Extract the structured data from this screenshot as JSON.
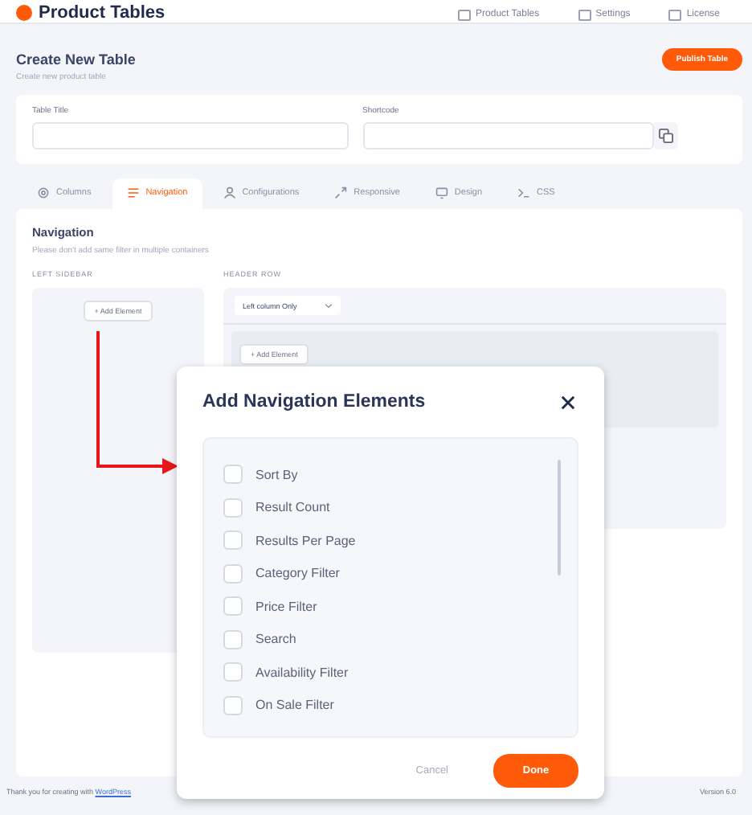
{
  "header": {
    "app_title": "Product Tables",
    "nav": [
      "Product Tables",
      "Settings",
      "License"
    ]
  },
  "page": {
    "title": "Create New Table",
    "subtitle": "Create new product table",
    "publish_button": "Publish Table"
  },
  "fields": [
    {
      "label": "Table Title"
    },
    {
      "label": "Shortcode"
    }
  ],
  "tabs": [
    {
      "label": "Columns",
      "selected": false
    },
    {
      "label": "Navigation",
      "selected": true
    },
    {
      "label": "Configurations",
      "selected": false
    },
    {
      "label": "Responsive",
      "selected": false
    },
    {
      "label": "Design",
      "selected": false
    },
    {
      "label": "CSS",
      "selected": false
    }
  ],
  "navigation": {
    "title": "Navigation",
    "hint": "Please don't add same filter in multiple containers",
    "left_sidebar": {
      "label": "LEFT SIDEBAR",
      "add_button": "+ Add Element"
    },
    "header_row": {
      "label": "HEADER ROW",
      "layout_select": "Left column Only",
      "add_button": "+ Add Element"
    }
  },
  "modal": {
    "title": "Add Navigation Elements",
    "items": [
      {
        "label": "Sort By",
        "checked": false
      },
      {
        "label": "Result Count",
        "checked": false
      },
      {
        "label": "Results Per Page",
        "checked": false
      },
      {
        "label": "Category Filter",
        "checked": false
      },
      {
        "label": "Price Filter",
        "checked": false
      },
      {
        "label": "Search",
        "checked": false
      },
      {
        "label": "Availability Filter",
        "checked": false
      },
      {
        "label": "On Sale Filter",
        "checked": false
      }
    ],
    "cancel": "Cancel",
    "done": "Done"
  },
  "footer": {
    "text_prefix": "Thank you for creating with",
    "link": "WordPress",
    "version": "Version 6.0"
  }
}
